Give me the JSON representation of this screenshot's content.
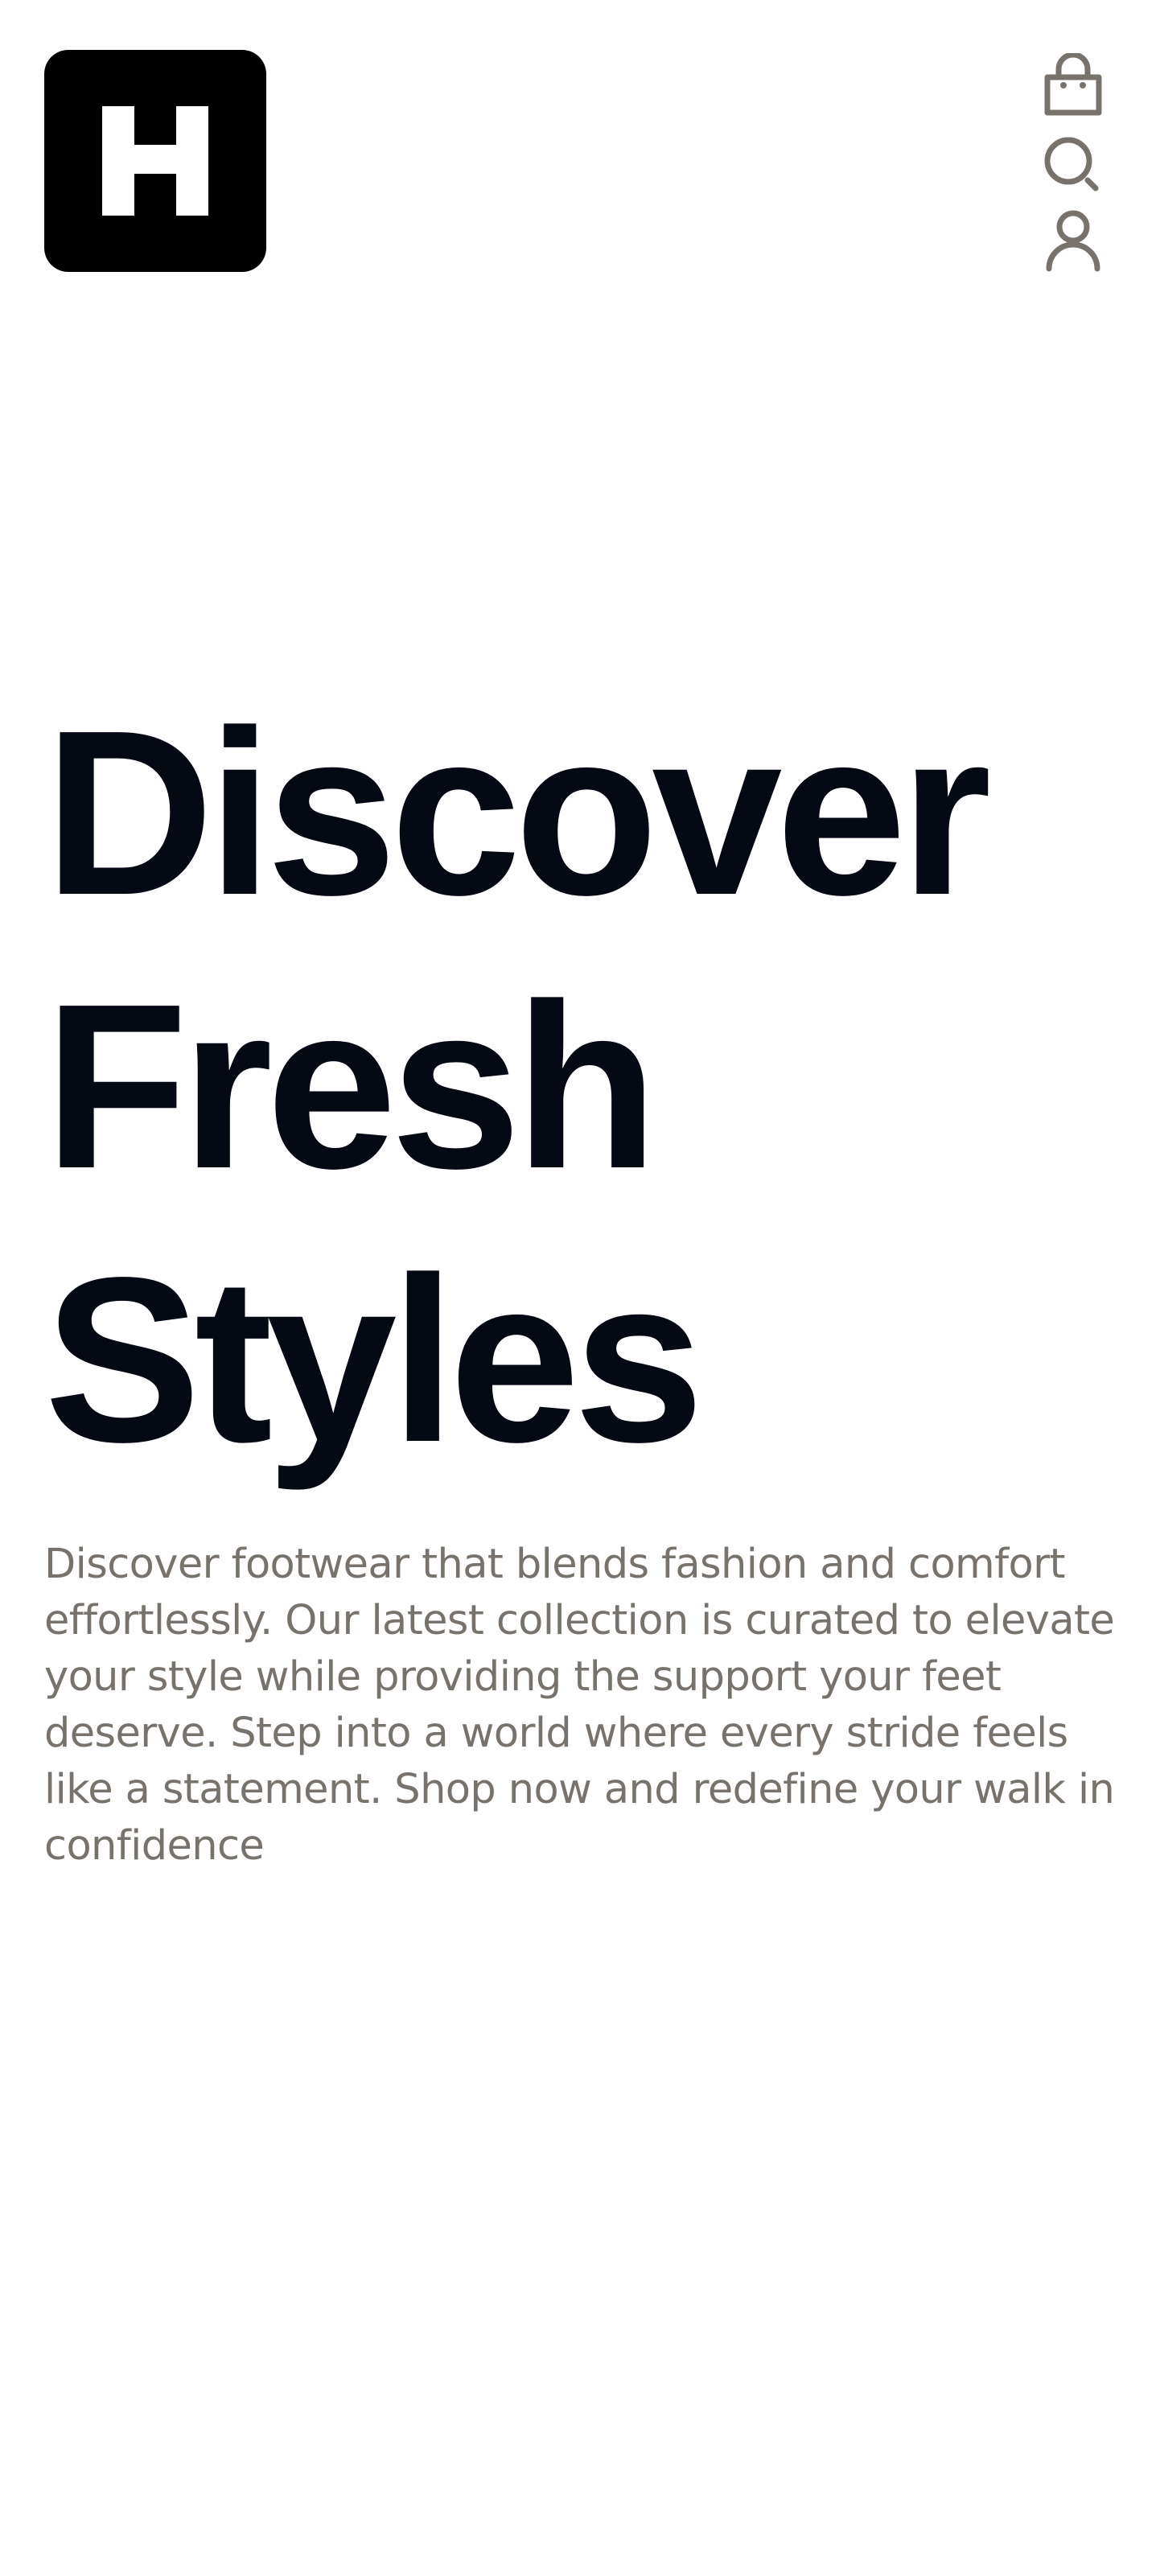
{
  "brand": {
    "logo_letter": "H",
    "logo_bg": "#000000",
    "logo_fg": "#ffffff"
  },
  "header": {
    "icons": [
      "shopping-bag-icon",
      "search-icon",
      "user-icon"
    ],
    "icon_color": "#77736c"
  },
  "hero": {
    "title_lines": [
      "Discover",
      "Fresh",
      "Styles"
    ],
    "title_color": "#050914",
    "description": "Discover footwear that blends fashion and comfort effortlessly. Our latest collection is curated to elevate your style while providing the support your feet deserve. Step into a world where every stride feels like a statement. Shop now and redefine your walk in confidence",
    "description_color": "#77736c"
  }
}
